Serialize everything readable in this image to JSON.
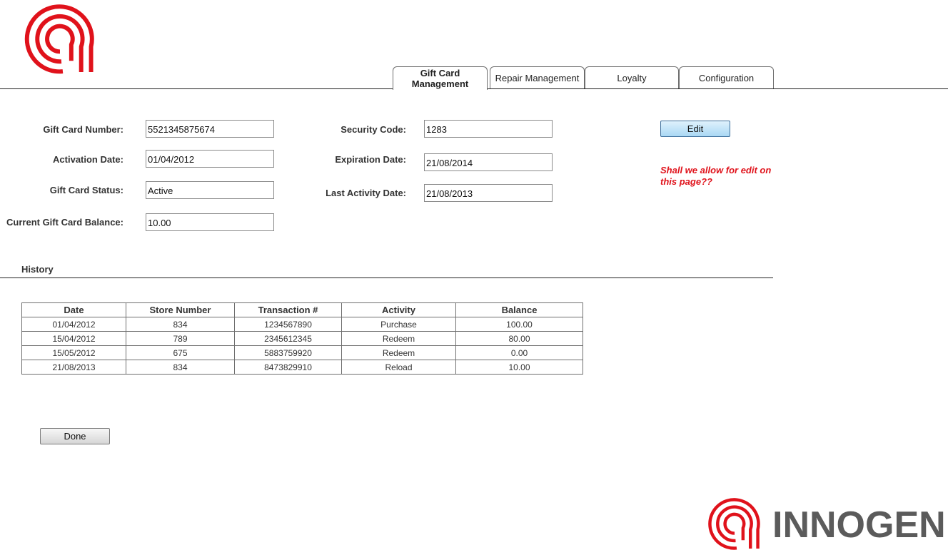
{
  "brand": {
    "name": "INNOGEN",
    "accent": "#e0121b",
    "text_color": "#5b5b5b"
  },
  "tabs": [
    {
      "label_line1": "Gift Card",
      "label_line2": "Management",
      "active": true
    },
    {
      "label": "Repair Management",
      "active": false
    },
    {
      "label": "Loyalty",
      "active": false
    },
    {
      "label": "Configuration",
      "active": false
    }
  ],
  "form": {
    "gift_card_number": {
      "label": "Gift Card Number:",
      "value": "5521345875674"
    },
    "activation_date": {
      "label": "Activation Date:",
      "value": "01/04/2012"
    },
    "gift_card_status": {
      "label": "Gift Card Status:",
      "value": "Active"
    },
    "current_balance": {
      "label": "Current Gift Card Balance:",
      "value": "10.00"
    },
    "security_code": {
      "label": "Security Code:",
      "value": "1283"
    },
    "expiration_date": {
      "label": "Expiration Date:",
      "value": "21/08/2014"
    },
    "last_activity_date": {
      "label": "Last Activity Date:",
      "value": "21/08/2013"
    }
  },
  "edit": {
    "label": "Edit",
    "note": "Shall we allow for edit on this page??"
  },
  "history": {
    "title": "History",
    "columns": [
      "Date",
      "Store Number",
      "Transaction #",
      "Activity",
      "Balance"
    ],
    "rows": [
      [
        "01/04/2012",
        "834",
        "1234567890",
        "Purchase",
        "100.00"
      ],
      [
        "15/04/2012",
        "789",
        "2345612345",
        "Redeem",
        "80.00"
      ],
      [
        "15/05/2012",
        "675",
        "5883759920",
        "Redeem",
        "0.00"
      ],
      [
        "21/08/2013",
        "834",
        "8473829910",
        "Reload",
        "10.00"
      ]
    ]
  },
  "done": {
    "label": "Done"
  }
}
